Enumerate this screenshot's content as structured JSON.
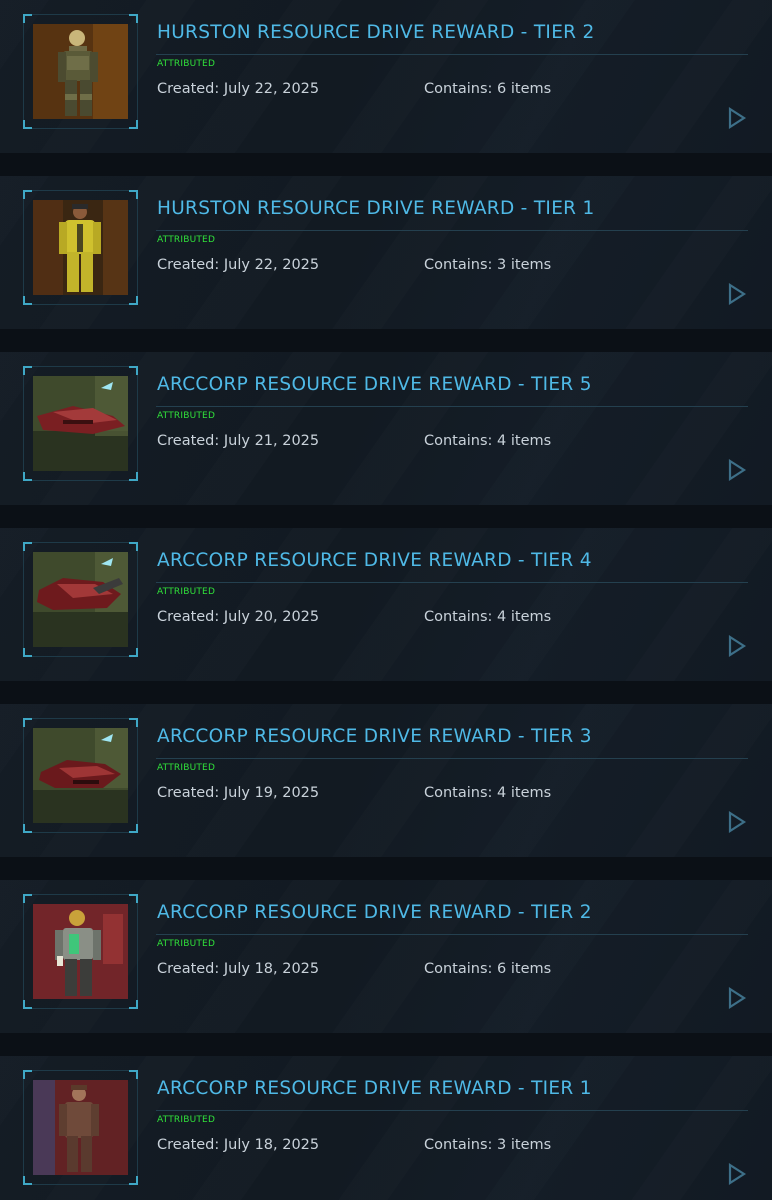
{
  "accent_color": "#4fb9e6",
  "status_color": "#30e03a",
  "rewards": [
    {
      "title": "HURSTON RESOURCE DRIVE REWARD - TIER 2",
      "status": "ATTRIBUTED",
      "created": "Created: July 22, 2025",
      "contains": "Contains: 6 items",
      "thumbnail": "armored-soldier"
    },
    {
      "title": "HURSTON RESOURCE DRIVE REWARD - TIER 1",
      "status": "ATTRIBUTED",
      "created": "Created: July 22, 2025",
      "contains": "Contains: 3 items",
      "thumbnail": "yellow-jumpsuit-character"
    },
    {
      "title": "ARCCORP RESOURCE DRIVE REWARD - TIER 5",
      "status": "ATTRIBUTED",
      "created": "Created: July 21, 2025",
      "contains": "Contains: 4 items",
      "thumbnail": "red-ship"
    },
    {
      "title": "ARCCORP RESOURCE DRIVE REWARD - TIER 4",
      "status": "ATTRIBUTED",
      "created": "Created: July 20, 2025",
      "contains": "Contains: 4 items",
      "thumbnail": "red-ship"
    },
    {
      "title": "ARCCORP RESOURCE DRIVE REWARD - TIER 3",
      "status": "ATTRIBUTED",
      "created": "Created: July 19, 2025",
      "contains": "Contains: 4 items",
      "thumbnail": "red-ship"
    },
    {
      "title": "ARCCORP RESOURCE DRIVE REWARD - TIER 2",
      "status": "ATTRIBUTED",
      "created": "Created: July 18, 2025",
      "contains": "Contains: 6 items",
      "thumbnail": "armored-character-red-city"
    },
    {
      "title": "ARCCORP RESOURCE DRIVE REWARD - TIER 1",
      "status": "ATTRIBUTED",
      "created": "Created: July 18, 2025",
      "contains": "Contains: 3 items",
      "thumbnail": "brown-suit-character"
    }
  ]
}
